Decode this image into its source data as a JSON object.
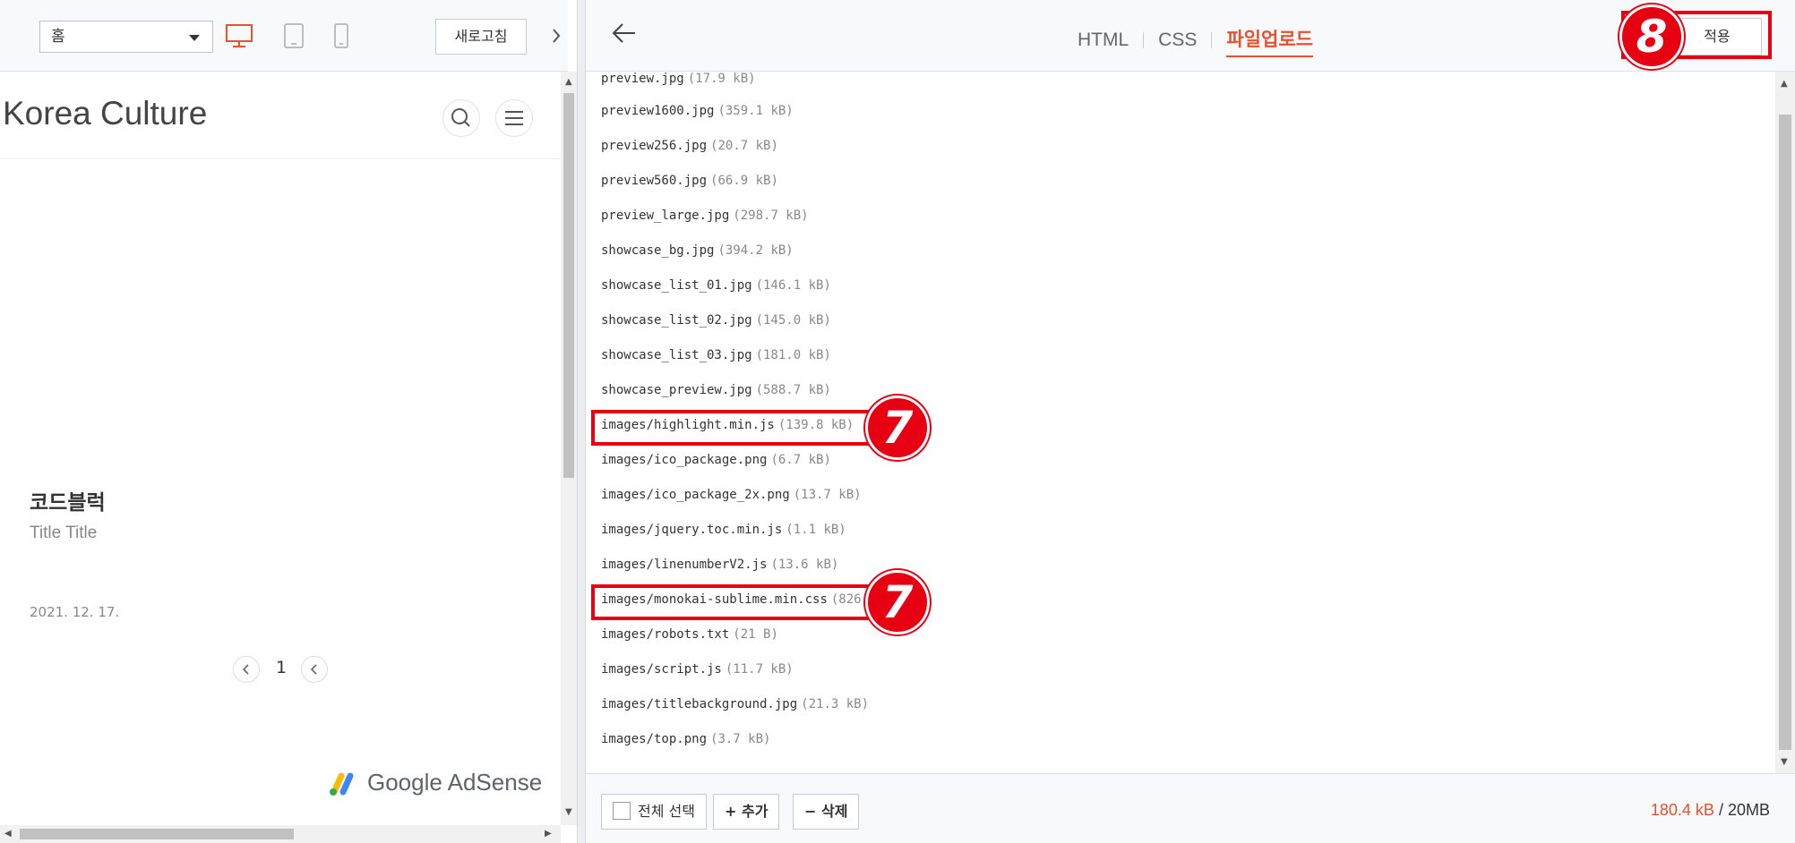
{
  "left": {
    "page_select": "홈",
    "refresh_label": "새로고침",
    "collapse_icon": "chevron-right-icon",
    "preview": {
      "site_title": "Korea Culture",
      "post_title": "코드블럭",
      "post_subtitle": "Title Title",
      "post_date": "2021. 12. 17.",
      "page_number": "1",
      "adsense_label": "Google AdSense"
    }
  },
  "right": {
    "tabs": [
      {
        "label": "HTML",
        "active": false
      },
      {
        "label": "CSS",
        "active": false
      },
      {
        "label": "파일업로드",
        "active": true
      }
    ],
    "apply_label": "적용",
    "files": [
      {
        "name": "preview.jpg",
        "size": "(17.9 kB)"
      },
      {
        "name": "preview1600.jpg",
        "size": "(359.1 kB)"
      },
      {
        "name": "preview256.jpg",
        "size": "(20.7 kB)"
      },
      {
        "name": "preview560.jpg",
        "size": "(66.9 kB)"
      },
      {
        "name": "preview_large.jpg",
        "size": "(298.7 kB)"
      },
      {
        "name": "showcase_bg.jpg",
        "size": "(394.2 kB)"
      },
      {
        "name": "showcase_list_01.jpg",
        "size": "(146.1 kB)"
      },
      {
        "name": "showcase_list_02.jpg",
        "size": "(145.0 kB)"
      },
      {
        "name": "showcase_list_03.jpg",
        "size": "(181.0 kB)"
      },
      {
        "name": "showcase_preview.jpg",
        "size": "(588.7 kB)"
      },
      {
        "name": "images/highlight.min.js",
        "size": "(139.8 kB)"
      },
      {
        "name": "images/ico_package.png",
        "size": "(6.7 kB)"
      },
      {
        "name": "images/ico_package_2x.png",
        "size": "(13.7 kB)"
      },
      {
        "name": "images/jquery.toc.min.js",
        "size": "(1.1 kB)"
      },
      {
        "name": "images/linenumberV2.js",
        "size": "(13.6 kB)"
      },
      {
        "name": "images/monokai-sublime.min.css",
        "size": "(826 B)"
      },
      {
        "name": "images/robots.txt",
        "size": "(21 B)"
      },
      {
        "name": "images/script.js",
        "size": "(11.7 kB)"
      },
      {
        "name": "images/titlebackground.jpg",
        "size": "(21.3 kB)"
      },
      {
        "name": "images/top.png",
        "size": "(3.7 kB)"
      }
    ],
    "footer": {
      "select_all_label": "전체 선택",
      "add_label": "+ 추가",
      "delete_label": "− 삭제",
      "usage_used": "180.4 kB",
      "usage_total": "/ 20MB"
    }
  },
  "annotations": {
    "badge_7": "7",
    "badge_8": "8"
  },
  "colors": {
    "accent": "#e8502e",
    "annotation": "#e60012"
  }
}
